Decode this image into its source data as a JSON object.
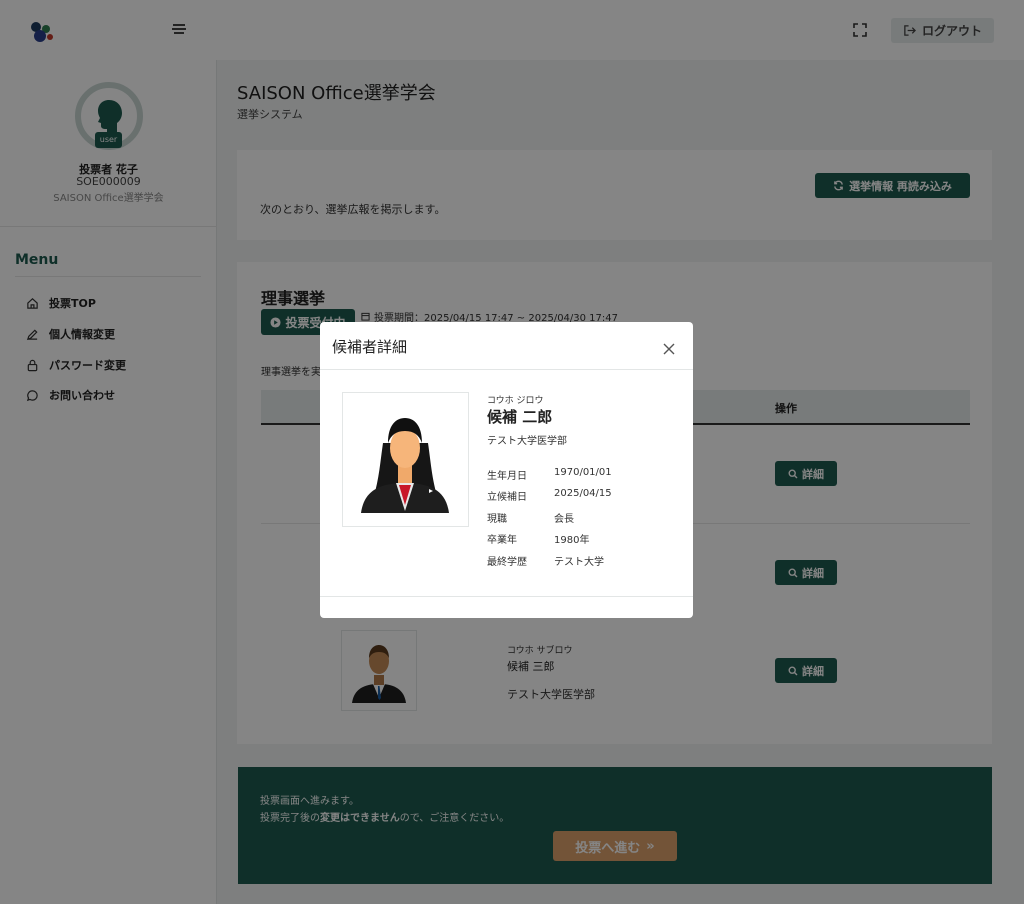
{
  "header": {
    "logout_label": "ログアウト"
  },
  "sidebar": {
    "avatar_badge": "user",
    "user_name": "投票者 花子",
    "user_id": "SOE000009",
    "user_org": "SAISON Office選挙学会",
    "menu_title": "Menu",
    "items": [
      {
        "label": "投票TOP",
        "icon": "home-icon"
      },
      {
        "label": "個人情報変更",
        "icon": "pencil-icon"
      },
      {
        "label": "パスワード変更",
        "icon": "lock-icon"
      },
      {
        "label": "お問い合わせ",
        "icon": "chat-icon"
      }
    ]
  },
  "main": {
    "title": "SAISON Office選挙学会",
    "subtitle": "選挙システム",
    "info_text": "次のとおり、選挙広報を掲示します。",
    "reload_label": "選挙情報 再読み込み",
    "election": {
      "title": "理事選挙",
      "status": "投票受付中",
      "period": "投票期間：2025/04/15 17:47 ~ 2025/04/30 17:47",
      "desc": "理事選挙を実",
      "col_operation": "操作",
      "detail_label": "詳細",
      "candidates": [
        {
          "kana": "コウホ サブロウ",
          "name": "候補 三郎",
          "faculty": "テスト大学医学部"
        }
      ]
    },
    "notice": {
      "line1": "投票画面へ進みます。",
      "line2_pre": "投票完了後の",
      "line2_bold": "変更はできません",
      "line2_post": "ので、ご注意ください。",
      "proceed_label": "投票へ進む"
    }
  },
  "modal": {
    "title": "候補者詳細",
    "kana": "コウホ ジロウ",
    "name": "候補 二郎",
    "faculty": "テスト大学医学部",
    "rows": [
      {
        "key": "生年月日",
        "value": "1970/01/01"
      },
      {
        "key": "立候補日",
        "value": "2025/04/15"
      },
      {
        "key": "現職",
        "value": "会長"
      },
      {
        "key": "卒業年",
        "value": "1980年"
      },
      {
        "key": "最終学歴",
        "value": "テスト大学"
      }
    ]
  },
  "colors": {
    "brand": "#1d5b4f",
    "accent": "#dca16b",
    "background": "#f1f4f4"
  }
}
